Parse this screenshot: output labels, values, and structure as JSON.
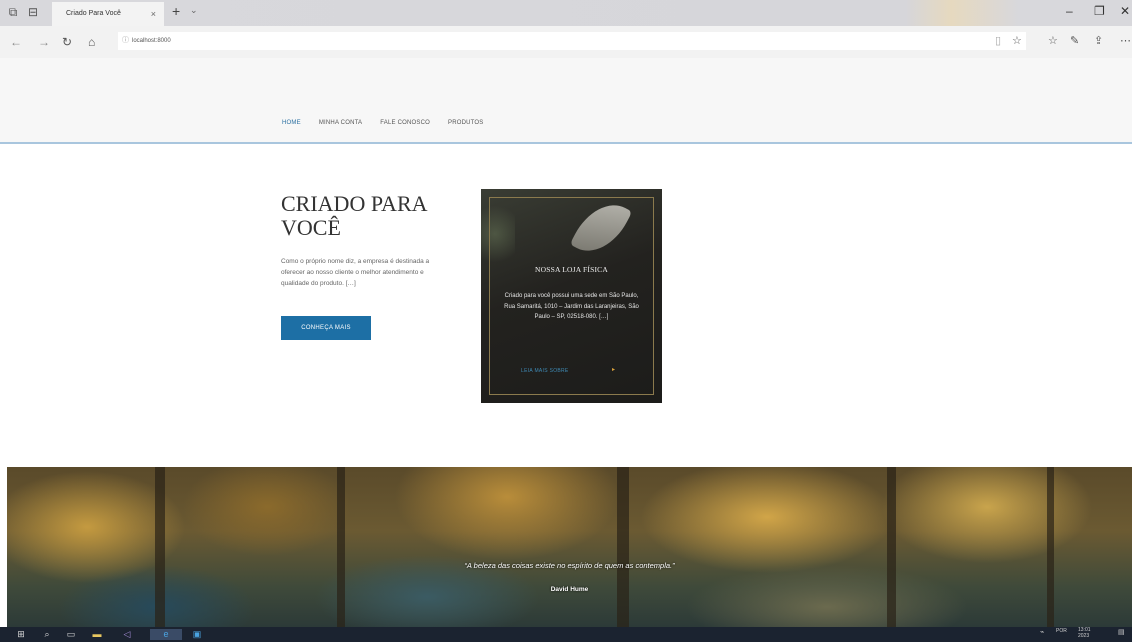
{
  "browser": {
    "tab_title": "Criado Para Você",
    "tab_close": "×",
    "new_tab": "+",
    "tab_dropdown": "⌄",
    "url": "localhost:8000",
    "icons": [
      "back-icon",
      "forward-icon",
      "refresh-icon",
      "home-icon",
      "favorites-star-icon",
      "hub-icon",
      "pen-icon",
      "share-icon",
      "more-icon"
    ],
    "window_controls": {
      "minimize": "–",
      "maximize": "❐",
      "close": "✕"
    }
  },
  "nav": {
    "items": [
      {
        "label": "HOME",
        "active": true
      },
      {
        "label": "MINHA CONTA",
        "active": false
      },
      {
        "label": "FALE CONOSCO",
        "active": false
      },
      {
        "label": "PRODUTOS",
        "active": false
      }
    ]
  },
  "hero": {
    "title": "CRIADO PARA VOCÊ",
    "text": "Como o próprio nome diz, a empresa é destinada a oferecer ao nosso cliente o melhor atendimento e qualidade do produto. […]",
    "button": "CONHEÇA MAIS"
  },
  "card": {
    "title": "NOSSA LOJA FÍSICA",
    "text": "Criado para você possui uma sede em São Paulo, Rua Samaritá, 1010 – Jardim das Laranjeiras, São Paulo – SP, 02518-080. […]",
    "link": "LEIA MAIS SOBRE",
    "arrow": "▸"
  },
  "banner": {
    "quote": "“A beleza das coisas existe no espírito de quem as contempla.”",
    "author": "David Hume"
  },
  "taskbar": {
    "icons": [
      "windows-start-icon",
      "search-icon",
      "task-view-icon",
      "file-explorer-icon",
      "visual-studio-icon",
      "edge-browser-icon",
      "app-icon"
    ],
    "tray_lang": "POR",
    "tray_time": "13:01",
    "tray_date": "2023"
  },
  "colors": {
    "accent": "#1d6fa5",
    "header_border": "#a9c6de",
    "card_bg": "#23221f",
    "taskbar": "#1b2330"
  }
}
